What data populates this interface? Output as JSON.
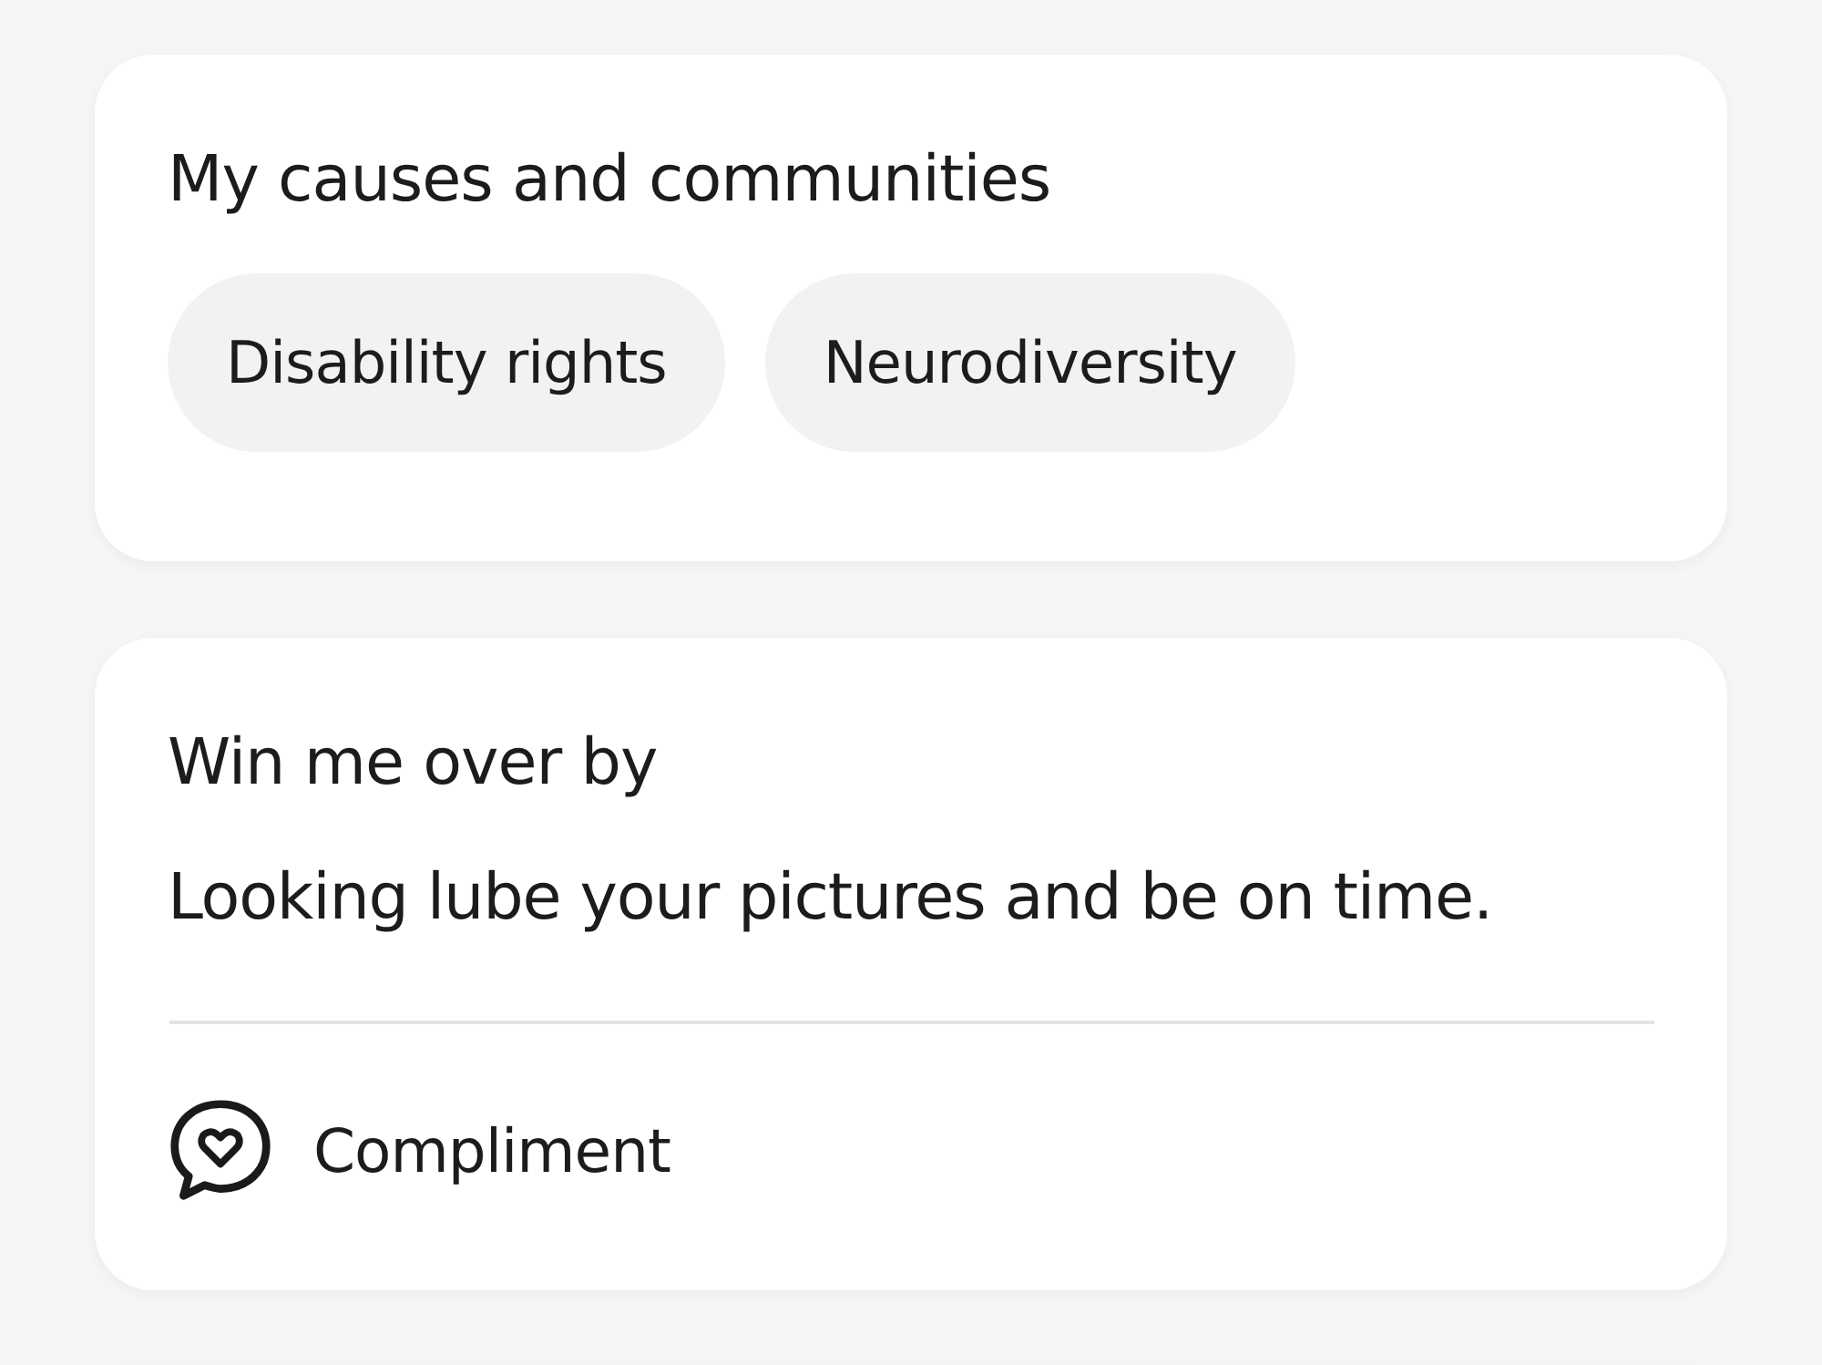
{
  "causes_card": {
    "title": "My causes and communities",
    "tags": [
      {
        "label": "Disability rights"
      },
      {
        "label": "Neurodiversity"
      }
    ]
  },
  "prompt_card": {
    "title": "Win me over by",
    "answer": "Looking lube your pictures and be on time.",
    "action": {
      "label": "Compliment"
    }
  }
}
